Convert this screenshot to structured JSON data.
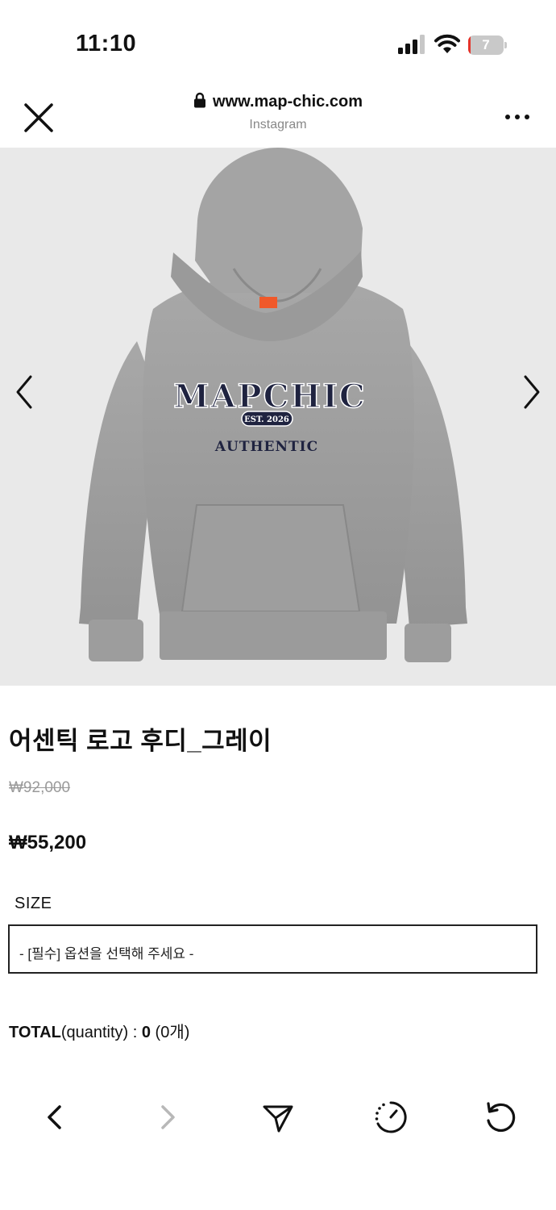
{
  "status_bar": {
    "time": "11:10",
    "battery_level": "7",
    "battery_color": "#e5332a"
  },
  "browser": {
    "url": "www.map-chic.com",
    "source": "Instagram",
    "close_icon": "close-icon",
    "more_icon": "more-horizontal-icon"
  },
  "gallery": {
    "image": "grey-hoodie-product-photo",
    "logo_main": "MAPCHIC",
    "logo_badge": "EST. 2026",
    "logo_sub": "AUTHENTIC",
    "prev_icon": "chevron-left-icon",
    "next_icon": "chevron-right-icon"
  },
  "product": {
    "title": "어센틱 로고 후디_그레이",
    "original_price": "₩92,000",
    "sale_price": "₩55,200"
  },
  "options": {
    "size_label": "SIZE",
    "size_placeholder": "- [필수] 옵션을 선택해 주세요 -"
  },
  "total": {
    "label": "TOTAL",
    "qty_label": "(quantity) : ",
    "amount": "0",
    "count": " (0개)"
  },
  "toolbar": {
    "back_icon": "back-icon",
    "forward_icon": "forward-icon",
    "share_icon": "send-icon",
    "history_icon": "history-icon",
    "reload_icon": "reload-icon"
  },
  "colors": {
    "gallery_bg": "#e9e9e9",
    "hoodie": "#9a9a9a",
    "navy": "#1f2340"
  }
}
